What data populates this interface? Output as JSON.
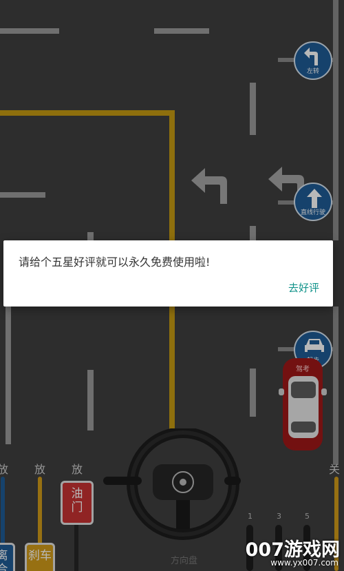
{
  "dialog": {
    "message": "请给个五星好评就可以永久免费使用啦!",
    "button": "去好评"
  },
  "signs": {
    "left_turn": "左转",
    "straight": "直线行驶",
    "start": "起步"
  },
  "car_tag": "驾考",
  "controls": {
    "left_labels": [
      "放",
      "放",
      "放"
    ],
    "right_label": "关",
    "pedal_left": "离合",
    "pedal_mid": "刹车",
    "pedal_right": "油门",
    "gear_numbers": [
      "1",
      "3",
      "5"
    ]
  },
  "steering_label": "方向盘",
  "watermark": {
    "brand": "007游戏网",
    "url": "www.yx007.com"
  },
  "colors": {
    "road": "#3f3f3f",
    "lane_dash": "#9a9a9a",
    "yellow_line": "#c59a12",
    "sign_blue": "#1f5c96",
    "dialog_button": "#11938a",
    "car_red": "#a01818"
  }
}
